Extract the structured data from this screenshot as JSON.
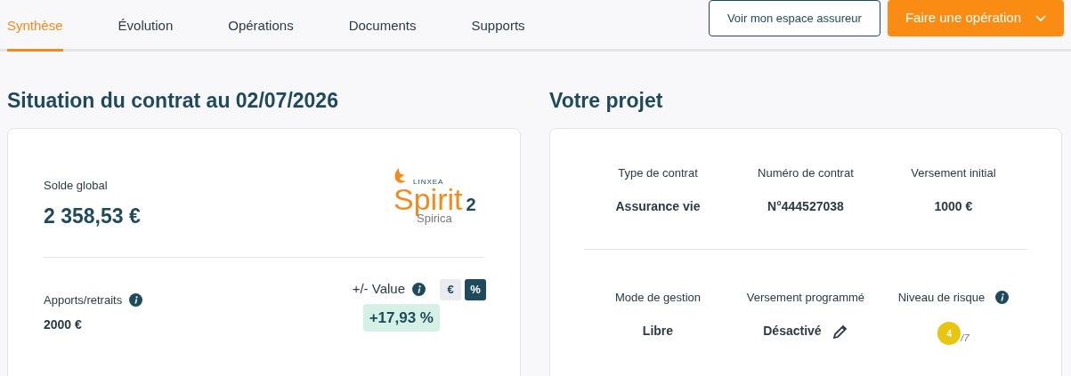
{
  "tabs": [
    {
      "label": "Synthèse",
      "selected": true
    },
    {
      "label": "Évolution",
      "selected": false
    },
    {
      "label": "Opérations",
      "selected": false
    },
    {
      "label": "Documents",
      "selected": false
    },
    {
      "label": "Supports",
      "selected": false
    }
  ],
  "actions": {
    "secondary": "Voir mon espace assureur",
    "primary": "Faire une opération"
  },
  "situation": {
    "title": "Situation du contrat au 02/07/2026",
    "balance_label": "Solde global",
    "balance": "2 358,53 €",
    "logo": {
      "brand": "LINXEA",
      "name": "Spirit",
      "number": "2",
      "partner": "Spirica"
    },
    "contributions_label": "Apports/retraits",
    "contributions": "2000 €",
    "gain_label": "+/- Value",
    "units": [
      {
        "label": "€",
        "selected": false
      },
      {
        "label": "%",
        "selected": true
      }
    ],
    "gain": "+17,93 %"
  },
  "project": {
    "title": "Votre projet",
    "fields": [
      {
        "label": "Type de contrat",
        "value": "Assurance vie",
        "kind": "text"
      },
      {
        "label": "Numéro de contrat",
        "value": "N°444527038",
        "kind": "text"
      },
      {
        "label": "Versement initial",
        "value": "1000 €",
        "kind": "text"
      },
      {
        "label": "Mode de gestion",
        "value": "Libre",
        "kind": "text"
      },
      {
        "label": "Versement programmé",
        "value": "Désactivé",
        "kind": "editable"
      },
      {
        "label": "Niveau de risque",
        "value": "4",
        "scale": "/7",
        "kind": "risk",
        "info": true
      }
    ]
  }
}
